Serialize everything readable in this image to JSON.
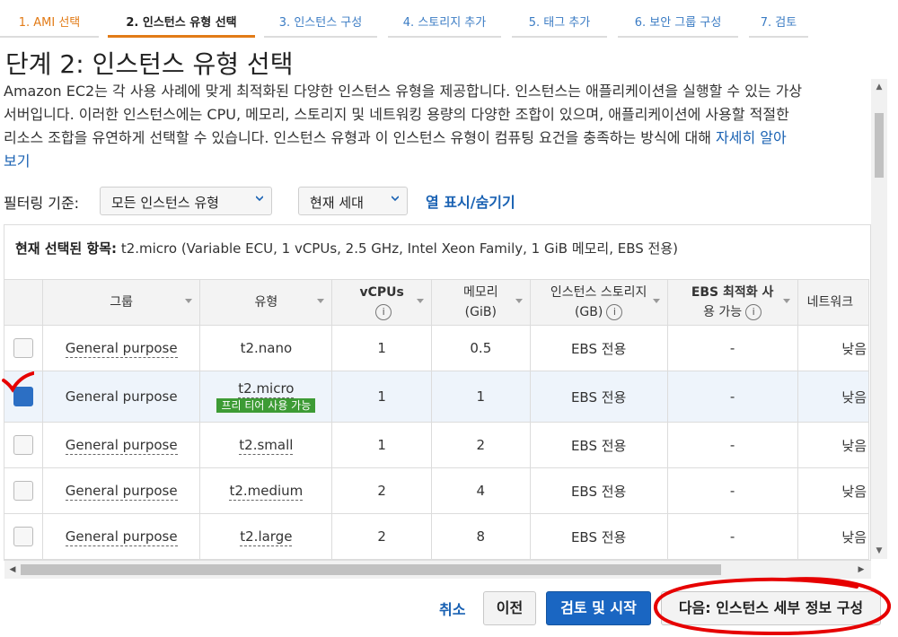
{
  "wizard": {
    "steps": [
      {
        "label": "1. AMI 선택"
      },
      {
        "label": "2. 인스턴스 유형 선택"
      },
      {
        "label": "3. 인스턴스 구성"
      },
      {
        "label": "4. 스토리지 추가"
      },
      {
        "label": "5. 태그 추가"
      },
      {
        "label": "6. 보안 그룹 구성"
      },
      {
        "label": "7. 검토"
      }
    ]
  },
  "page": {
    "title": "단계 2: 인스턴스 유형 선택",
    "intro_line1": "Amazon EC2는 각 사용 사례에 맞게 최적화된 다양한 인스턴스 유형을 제공합니다. 인스턴스는 애플리케이션을 실행할 수 있는 가상",
    "intro_line2": "서버입니다. 이러한 인스턴스에는 CPU, 메모리, 스토리지 및 네트워킹 용량의 다양한 조합이 있으며, 애플리케이션에 사용할 적절한",
    "intro_line3": "리소스 조합을 유연하게 선택할 수 있습니다. 인스턴스 유형과 이 인스턴스 유형이 컴퓨팅 요건을 충족하는 방식에 대해 ",
    "learn_more": "자세히 알아",
    "learn_more_cont": "보기"
  },
  "filter": {
    "label": "필터링 기준:",
    "family_value": "모든 인스턴스 유형",
    "generation_value": "현재 세대",
    "toggle_columns": "열 표시/숨기기"
  },
  "selection": {
    "prefix": "현재 선택된 항목:",
    "detail": " t2.micro (Variable ECU, 1 vCPUs, 2.5 GHz, Intel Xeon Family, 1 GiB 메모리, EBS 전용)"
  },
  "table": {
    "headers": {
      "group": "그룹",
      "type": "유형",
      "vcpus": "vCPUs",
      "memory": "메모리",
      "memory_unit": "(GiB)",
      "storage": "인스턴스 스토리지",
      "storage_unit": "(GB)",
      "ebs": "EBS 최적화 사",
      "ebs2": "용 가능",
      "network": "네트워크"
    },
    "info_icon": "i",
    "free_tier": "프리 티어 사용 가능",
    "rows": [
      {
        "group": "General purpose",
        "type": "t2.nano",
        "vcpus": "1",
        "memory": "0.5",
        "storage": "EBS 전용",
        "ebs": "-",
        "network": "낮음"
      },
      {
        "group": "General purpose",
        "type": "t2.micro",
        "vcpus": "1",
        "memory": "1",
        "storage": "EBS 전용",
        "ebs": "-",
        "network": "낮음"
      },
      {
        "group": "General purpose",
        "type": "t2.small",
        "vcpus": "1",
        "memory": "2",
        "storage": "EBS 전용",
        "ebs": "-",
        "network": "낮음"
      },
      {
        "group": "General purpose",
        "type": "t2.medium",
        "vcpus": "2",
        "memory": "4",
        "storage": "EBS 전용",
        "ebs": "-",
        "network": "낮음"
      },
      {
        "group": "General purpose",
        "type": "t2.large",
        "vcpus": "2",
        "memory": "8",
        "storage": "EBS 전용",
        "ebs": "-",
        "network": "낮음"
      }
    ]
  },
  "footer": {
    "cancel": "취소",
    "prev": "이전",
    "review": "검토 및 시작",
    "next": "다음: 인스턴스 세부 정보 구성"
  },
  "colors": {
    "accent": "#e27b17",
    "link": "#1a62b3",
    "primary_button": "#1a66c2",
    "free_tier_badge": "#3d9b35",
    "annotation_red": "#e60000"
  }
}
